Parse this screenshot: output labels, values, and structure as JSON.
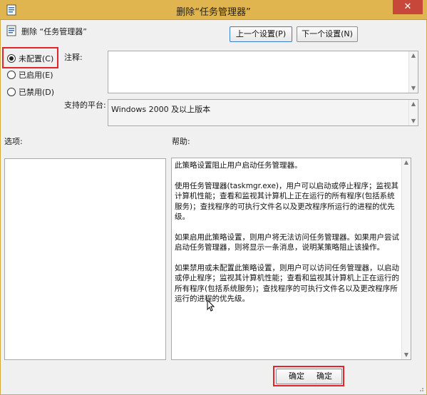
{
  "window": {
    "title": "删除“任务管理器”",
    "close_label": "✕"
  },
  "policy": {
    "name": "删除 “任务管理器”"
  },
  "nav": {
    "prev_label": "上一个设置(P)",
    "next_label": "下一个设置(N)"
  },
  "state": {
    "options": [
      {
        "label": "未配置(C)",
        "checked": true
      },
      {
        "label": "已启用(E)",
        "checked": false
      },
      {
        "label": "已禁用(D)",
        "checked": false
      }
    ]
  },
  "labels": {
    "comment": "注释:",
    "platform": "支持的平台:",
    "options": "选项:",
    "help": "帮助:"
  },
  "platform_value": "Windows 2000 及以上版本",
  "help_paragraphs": [
    "此策略设置阻止用户启动任务管理器。",
    "使用任务管理器(taskmgr.exe)，用户可以启动或停止程序；监视其计算机性能；查看和监视其计算机上正在运行的所有程序(包括系统服务)；查找程序的可执行文件名以及更改程序所运行的进程的优先级。",
    "如果启用此策略设置，则用户将无法访问任务管理器。如果用户尝试启动任务管理器，则将显示一条消息，说明某策略阻止该操作。",
    "如果禁用或未配置此策略设置，则用户可以访问任务管理器，以启动或停止程序；监视其计算机性能；查看和监视其计算机上正在运行的所有程序(包括系统服务)；查找程序的可执行文件名以及更改程序所运行的进程的优先级。"
  ],
  "footer": {
    "ok_label": "确定",
    "partial_label": "确定"
  },
  "colors": {
    "titlebar": "#e0b44e",
    "highlight": "#e0262b",
    "close": "#c7483a"
  }
}
